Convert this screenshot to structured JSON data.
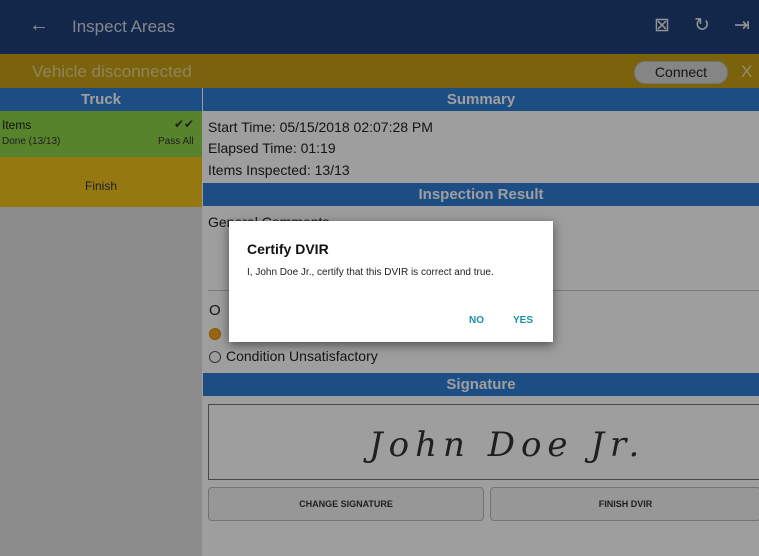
{
  "appbar": {
    "title": "Inspect Areas",
    "back_icon": "←",
    "icons": {
      "export": "⊠",
      "refresh": "↻",
      "logout": "⇥"
    }
  },
  "banner": {
    "text": "Vehicle disconnected",
    "connect_label": "Connect",
    "close_label": "X"
  },
  "left": {
    "header": "Truck",
    "items": {
      "label": "Items",
      "status": "Done (13/13)",
      "check": "✔✔",
      "pass_all": "Pass All"
    },
    "finish": "Finish"
  },
  "summary": {
    "header": "Summary",
    "start_time": "Start Time: 05/15/2018 02:07:28 PM",
    "elapsed_time": "Elapsed Time: 01:19",
    "items_inspected": "Items Inspected: 13/13"
  },
  "inspection": {
    "header": "Inspection Result",
    "comments_label": "General Comments",
    "radio_c": "O",
    "condition_unsatisfactory": "Condition Unsatisfactory"
  },
  "signature": {
    "header": "Signature",
    "signed_name": "John Doe Jr.",
    "change_label": "CHANGE SIGNATURE",
    "finish_label": "FINISH DVIR"
  },
  "dialog": {
    "title": "Certify DVIR",
    "message": "I, John Doe Jr., certify that this DVIR is correct and true.",
    "no_label": "NO",
    "yes_label": "YES"
  },
  "colors": {
    "appbar": "#1f3f7a",
    "banner": "#c79f15",
    "header": "#2f7fd4",
    "items_green": "#8dd447",
    "finish_yellow": "#f2c21c",
    "dialog_button": "#1b8fa3"
  }
}
